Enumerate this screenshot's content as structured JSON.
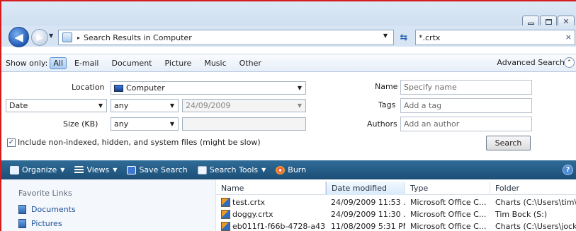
{
  "window": {
    "buttons": {
      "minimize": "minimize-icon",
      "maximize": "maximize-icon",
      "close": "close-icon"
    }
  },
  "address": {
    "text": "Search Results in Computer",
    "separator": "▸"
  },
  "search": {
    "value": "*.crtx",
    "clear": "×"
  },
  "filter": {
    "show_only": "Show only:",
    "buttons": [
      "All",
      "E-mail",
      "Document",
      "Picture",
      "Music",
      "Other"
    ],
    "active": "All",
    "advanced": "Advanced Search"
  },
  "advanced": {
    "location_label": "Location",
    "location_value": "Computer",
    "date_field": "Date",
    "date_op": "any",
    "date_value": "24/09/2009",
    "size_label": "Size (KB)",
    "size_op": "any",
    "size_value": "",
    "name_label": "Name",
    "name_placeholder": "Specify name",
    "tags_label": "Tags",
    "tags_placeholder": "Add a tag",
    "authors_label": "Authors",
    "authors_placeholder": "Add an author",
    "include_checked": true,
    "include_label": "Include non-indexed, hidden, and system files (might be slow)",
    "search_button": "Search"
  },
  "toolbar": {
    "organize": "Organize",
    "views": "Views",
    "save_search": "Save Search",
    "search_tools": "Search Tools",
    "burn": "Burn",
    "help": "?"
  },
  "favorites": {
    "heading": "Favorite Links",
    "items": [
      "Documents",
      "Pictures"
    ]
  },
  "files": {
    "columns": [
      "Name",
      "Date modified",
      "Type",
      "Folder"
    ],
    "sorted_column": "Date modified",
    "rows": [
      {
        "name": "test.crtx",
        "date": "24/09/2009 11:53 ...",
        "type": "Microsoft Office C...",
        "folder": "Charts (C:\\Users\\tim\\A"
      },
      {
        "name": "doggy.crtx",
        "date": "24/09/2009 11:30 ...",
        "type": "Microsoft Office C...",
        "folder": "Tim Bock (S:)"
      },
      {
        "name": "eb011f1-f66b-4728-a43...",
        "date": "11/08/2009 5:31 PM",
        "type": "Microsoft Office C...",
        "folder": "Charts (C:\\Users\\jock\\"
      }
    ]
  },
  "colors": {
    "toolbar": "#1f5580",
    "frame": "#d41c1c",
    "link": "#1d4f9c"
  }
}
